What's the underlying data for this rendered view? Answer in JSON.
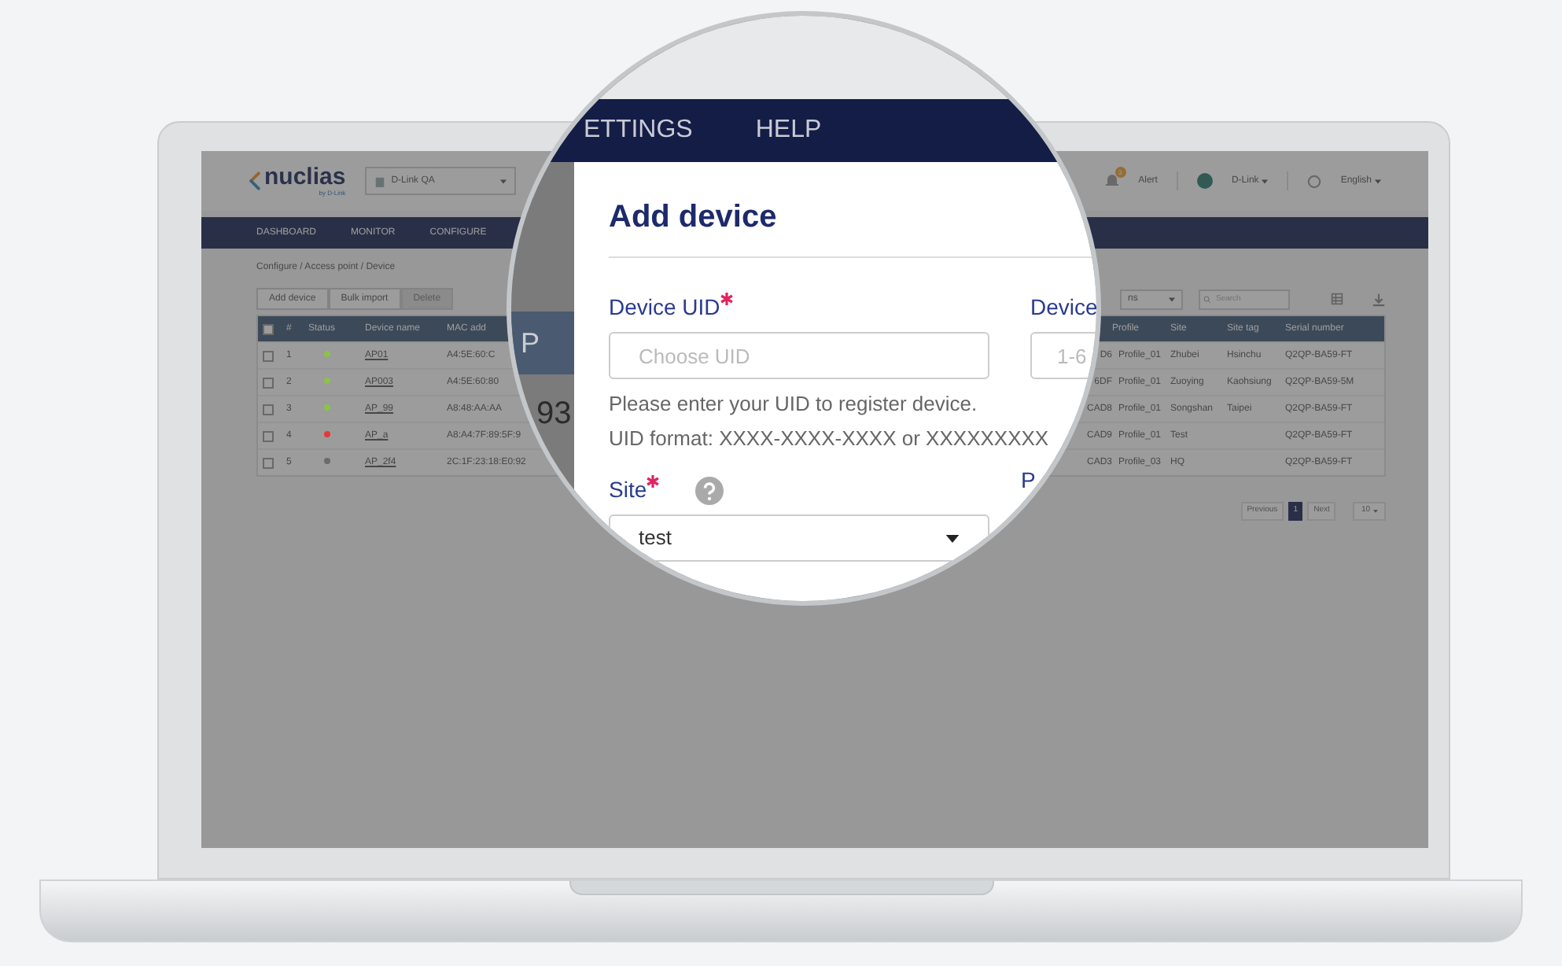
{
  "screen": {
    "logo": {
      "name": "nuclias",
      "tagline": "by D-Link"
    },
    "org_select": "D-Link QA",
    "header_right": {
      "alert_count": "3",
      "alert": "Alert",
      "user": "D-Link",
      "language": "English"
    },
    "nav": [
      "DASHBOARD",
      "MONITOR",
      "CONFIGURE"
    ],
    "breadcrumb": "Configure / Access point / Device",
    "actions": [
      {
        "label": "Add device",
        "disabled": false
      },
      {
        "label": "Bulk import",
        "disabled": false
      },
      {
        "label": "Delete",
        "disabled": true
      }
    ],
    "filter_select": "ns",
    "search_placeholder": "Search",
    "table": {
      "select_all": {
        "checked": false
      },
      "columns_left": [
        "#",
        "Status",
        "Device name",
        "MAC add"
      ],
      "columns_right": [
        "Profile",
        "Site",
        "Site tag",
        "Serial number"
      ],
      "rows": [
        {
          "checked": false,
          "index": "1",
          "color": "#8bc34a",
          "name": "AP01",
          "mac": "A4:5E:60:C",
          "column_6": "D6",
          "profile": "Profile_01",
          "site": "Zhubei",
          "site_tag": "Hsinchu",
          "serial": "Q2QP-BA59-FT"
        },
        {
          "checked": false,
          "index": "2",
          "color": "#8bc34a",
          "name": "AP003",
          "mac": "A4:5E:60:80",
          "column_6": "6DF",
          "profile": "Profile_01",
          "site": "Zuoying",
          "site_tag": "Kaohsiung",
          "serial": "Q2QP-BA59-5M"
        },
        {
          "checked": false,
          "index": "3",
          "color": "#8bc34a",
          "name": "AP_99",
          "mac": "A8:48:AA:AA",
          "column_6": "CAD8",
          "profile": "Profile_01",
          "site": "Songshan",
          "site_tag": "Taipei",
          "serial": "Q2QP-BA59-FT"
        },
        {
          "checked": false,
          "index": "4",
          "color": "#e53935",
          "name": "AP_a",
          "mac": "A8:A4:7F:89:5F:9",
          "column_6": "CAD9",
          "profile": "Profile_01",
          "site": "Test",
          "serial": "Q2QP-BA59-FT"
        },
        {
          "checked": false,
          "index": "5",
          "color": "#6b6b6b",
          "name": "AP_2f4",
          "mac": "2C:1F:23:18:E0:92",
          "column_6": "CAD3",
          "profile": "Profile_03",
          "site": "HQ",
          "serial": "Q2QP-BA59-FT"
        }
      ]
    },
    "pagination": {
      "previous": "Previous",
      "pages": [
        {
          "label": "1",
          "selected": true
        }
      ],
      "next": "Next",
      "page_size": "10"
    }
  },
  "magnifier": {
    "nav": [
      "ETTINGS",
      "HELP"
    ],
    "card_header": "P",
    "card_value": "93",
    "dialog": {
      "title": "Add device",
      "uid": {
        "label": "Device UID",
        "required": true,
        "placeholder": "Choose UID",
        "help": [
          "Please enter your UID to register device.",
          "UID format: XXXX-XXXX-XXXX or XXXXXXXXX"
        ]
      },
      "device": {
        "label": "Device",
        "placeholder": "1-6"
      },
      "site": {
        "label": "Site",
        "required": true,
        "value": "test"
      },
      "right_label": "P"
    }
  }
}
